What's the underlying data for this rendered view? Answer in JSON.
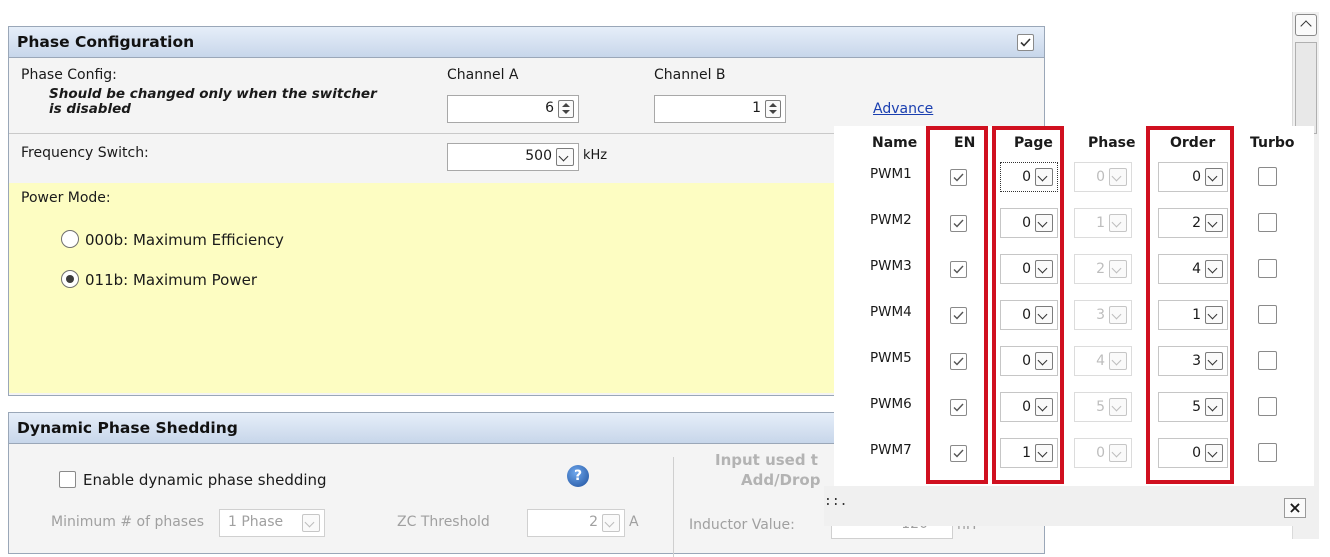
{
  "phase_config": {
    "title": "Phase Configuration",
    "phase_config_label": "Phase Config:",
    "note": "Should be changed only when the switcher is disabled",
    "channel_a_label": "Channel A",
    "channel_b_label": "Channel B",
    "channel_a_value": "6",
    "channel_b_value": "1",
    "frequency_label": "Frequency Switch:",
    "frequency_value": "500",
    "frequency_unit": "kHz",
    "advance_link": "Advance",
    "power_mode_label": "Power Mode:",
    "power_modes": [
      {
        "label": "000b: Maximum Efficiency",
        "selected": false
      },
      {
        "label": "011b: Maximum Power",
        "selected": true
      }
    ]
  },
  "shedding": {
    "title": "Dynamic Phase Shedding",
    "enable_label": "Enable dynamic phase shedding",
    "min_phases_label": "Minimum # of phases",
    "min_phases_value": "1 Phase",
    "zc_label": "ZC Threshold",
    "zc_value": "2",
    "zc_unit": "A",
    "input_used_line1": "Input used t",
    "input_used_line2": "Add/Drop",
    "inductor_label": "Inductor Value:",
    "inductor_value": "120",
    "inductor_unit": "nH"
  },
  "pwm_table": {
    "headers": {
      "name": "Name",
      "en": "EN",
      "page": "Page",
      "phase": "Phase",
      "order": "Order",
      "turbo": "Turbo"
    },
    "rows": [
      {
        "name": "PWM1",
        "en": true,
        "page": "0",
        "phase": "0",
        "order": "0",
        "turbo": false
      },
      {
        "name": "PWM2",
        "en": true,
        "page": "0",
        "phase": "1",
        "order": "2",
        "turbo": false
      },
      {
        "name": "PWM3",
        "en": true,
        "page": "0",
        "phase": "2",
        "order": "4",
        "turbo": false
      },
      {
        "name": "PWM4",
        "en": true,
        "page": "0",
        "phase": "3",
        "order": "1",
        "turbo": false
      },
      {
        "name": "PWM5",
        "en": true,
        "page": "0",
        "phase": "4",
        "order": "3",
        "turbo": false
      },
      {
        "name": "PWM6",
        "en": true,
        "page": "0",
        "phase": "5",
        "order": "5",
        "turbo": false
      },
      {
        "name": "PWM7",
        "en": true,
        "page": "1",
        "phase": "0",
        "order": "0",
        "turbo": false
      }
    ],
    "close_glyph": "×",
    "grip_glyph": "::."
  },
  "colors": {
    "highlight_box": "#d0101f",
    "power_mode_bg": "#fdfdc2",
    "header_gradient_top": "#e6eef9"
  }
}
